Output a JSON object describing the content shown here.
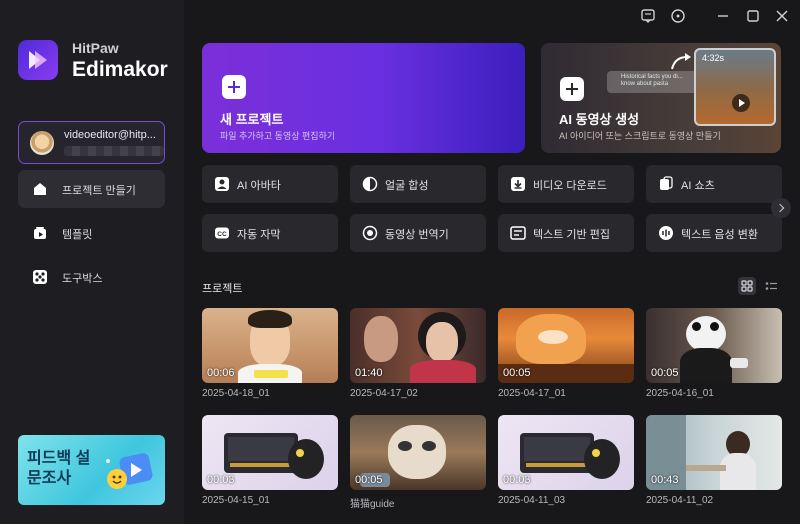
{
  "app": {
    "brand_small": "HitPaw",
    "brand_big": "Edimakor"
  },
  "account": {
    "name": "videoeditor@hitp..."
  },
  "nav": [
    {
      "label": "프로젝트 만들기",
      "icon": "home-icon",
      "active": true
    },
    {
      "label": "템플릿",
      "icon": "template-icon",
      "active": false
    },
    {
      "label": "도구박스",
      "icon": "toolbox-icon",
      "active": false
    }
  ],
  "banner": {
    "text": "피드백 설문조사"
  },
  "hero": {
    "new_project": {
      "title": "새 프로젝트",
      "subtitle": "파일 추가하고 동영상 편집하기"
    },
    "ai_video": {
      "title": "AI 동영상 생성",
      "subtitle": "AI 아이디어 또는 스크립트로 동영상 만들기",
      "tip": "Historical facts you di... know about pasta",
      "thumb_time": "4:32s"
    }
  },
  "tools": [
    {
      "label": "AI 아바타",
      "icon": "avatar-icon"
    },
    {
      "label": "얼굴 합성",
      "icon": "face-swap-icon"
    },
    {
      "label": "비디오 다운로드",
      "icon": "download-icon"
    },
    {
      "label": "AI 쇼츠",
      "icon": "shorts-icon"
    },
    {
      "label": "자동 자막",
      "icon": "cc-icon"
    },
    {
      "label": "동영상 번역기",
      "icon": "translate-icon"
    },
    {
      "label": "텍스트 기반 편집",
      "icon": "text-edit-icon"
    },
    {
      "label": "텍스트 음성 변환",
      "icon": "tts-icon"
    }
  ],
  "projects_title": "프로젝트",
  "projects": [
    {
      "name": "2025-04-18_01",
      "duration": "00:06"
    },
    {
      "name": "2025-04-17_02",
      "duration": "01:40"
    },
    {
      "name": "2025-04-17_01",
      "duration": "00:05"
    },
    {
      "name": "2025-04-16_01",
      "duration": "00:05"
    },
    {
      "name": "2025-04-15_01",
      "duration": "00:03"
    },
    {
      "name": "猫猫guide",
      "duration": "00:05"
    },
    {
      "name": "2025-04-11_03",
      "duration": "00:03"
    },
    {
      "name": "2025-04-11_02",
      "duration": "00:43"
    }
  ],
  "colors": {
    "accent": "#7b2fd9",
    "background": "#18181b",
    "sidebar": "#1e1e22",
    "tool_bg": "#28282d"
  }
}
